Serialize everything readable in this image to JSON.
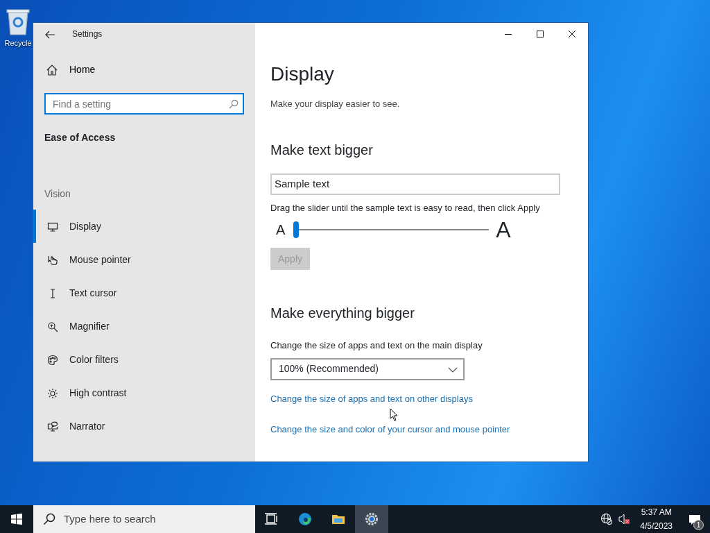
{
  "desktop": {
    "icons": [
      {
        "label": "Recycle"
      }
    ]
  },
  "window": {
    "title": "Settings",
    "home": "Home",
    "search": {
      "placeholder": "Find a setting"
    },
    "category": "Ease of Access",
    "section": "Vision",
    "nav": [
      {
        "label": "Display",
        "kind": "display",
        "selected": true
      },
      {
        "label": "Mouse pointer",
        "kind": "hand",
        "selected": false
      },
      {
        "label": "Text cursor",
        "kind": "ibeam",
        "selected": false
      },
      {
        "label": "Magnifier",
        "kind": "magnifier",
        "selected": false
      },
      {
        "label": "Color filters",
        "kind": "palette",
        "selected": false
      },
      {
        "label": "High contrast",
        "kind": "sun",
        "selected": false
      },
      {
        "label": "Narrator",
        "kind": "narrator",
        "selected": false
      }
    ]
  },
  "content": {
    "title": "Display",
    "subtitle": "Make your display easier to see.",
    "text_size": {
      "heading": "Make text bigger",
      "sample": "Sample text",
      "hint": "Drag the slider until the sample text is easy to read, then click Apply",
      "small_a": "A",
      "large_a": "A",
      "level": 0,
      "apply": {
        "label": "Apply",
        "disabled": true
      }
    },
    "scale": {
      "heading": "Make everything bigger",
      "label": "Change the size of apps and text on the main display",
      "value": "100% (Recommended)",
      "links": [
        "Change the size of apps and text on other displays",
        "Change the size and color of your cursor and mouse pointer"
      ]
    }
  },
  "taskbar": {
    "search_placeholder": "Type here to search",
    "apps": [
      {
        "kind": "task-view",
        "selected": false
      },
      {
        "kind": "edge",
        "selected": false
      },
      {
        "kind": "explorer",
        "selected": false
      },
      {
        "kind": "settings",
        "selected": true
      }
    ],
    "time": "5:37 AM",
    "date": "4/5/2023",
    "notifications": "1"
  }
}
